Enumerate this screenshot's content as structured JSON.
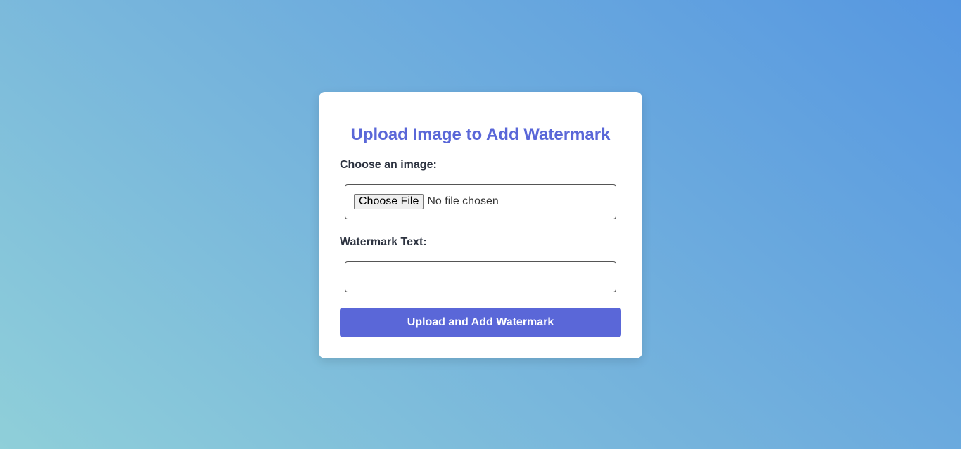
{
  "form": {
    "title": "Upload Image to Add Watermark",
    "image_label": "Choose an image:",
    "file_button_label": "Choose File",
    "file_status": "No file chosen",
    "watermark_label": "Watermark Text:",
    "watermark_value": "",
    "watermark_placeholder": "",
    "submit_label": "Upload and Add Watermark"
  },
  "colors": {
    "accent": "#5a67d8",
    "card_background": "#ffffff",
    "label_text": "#2d3340"
  }
}
